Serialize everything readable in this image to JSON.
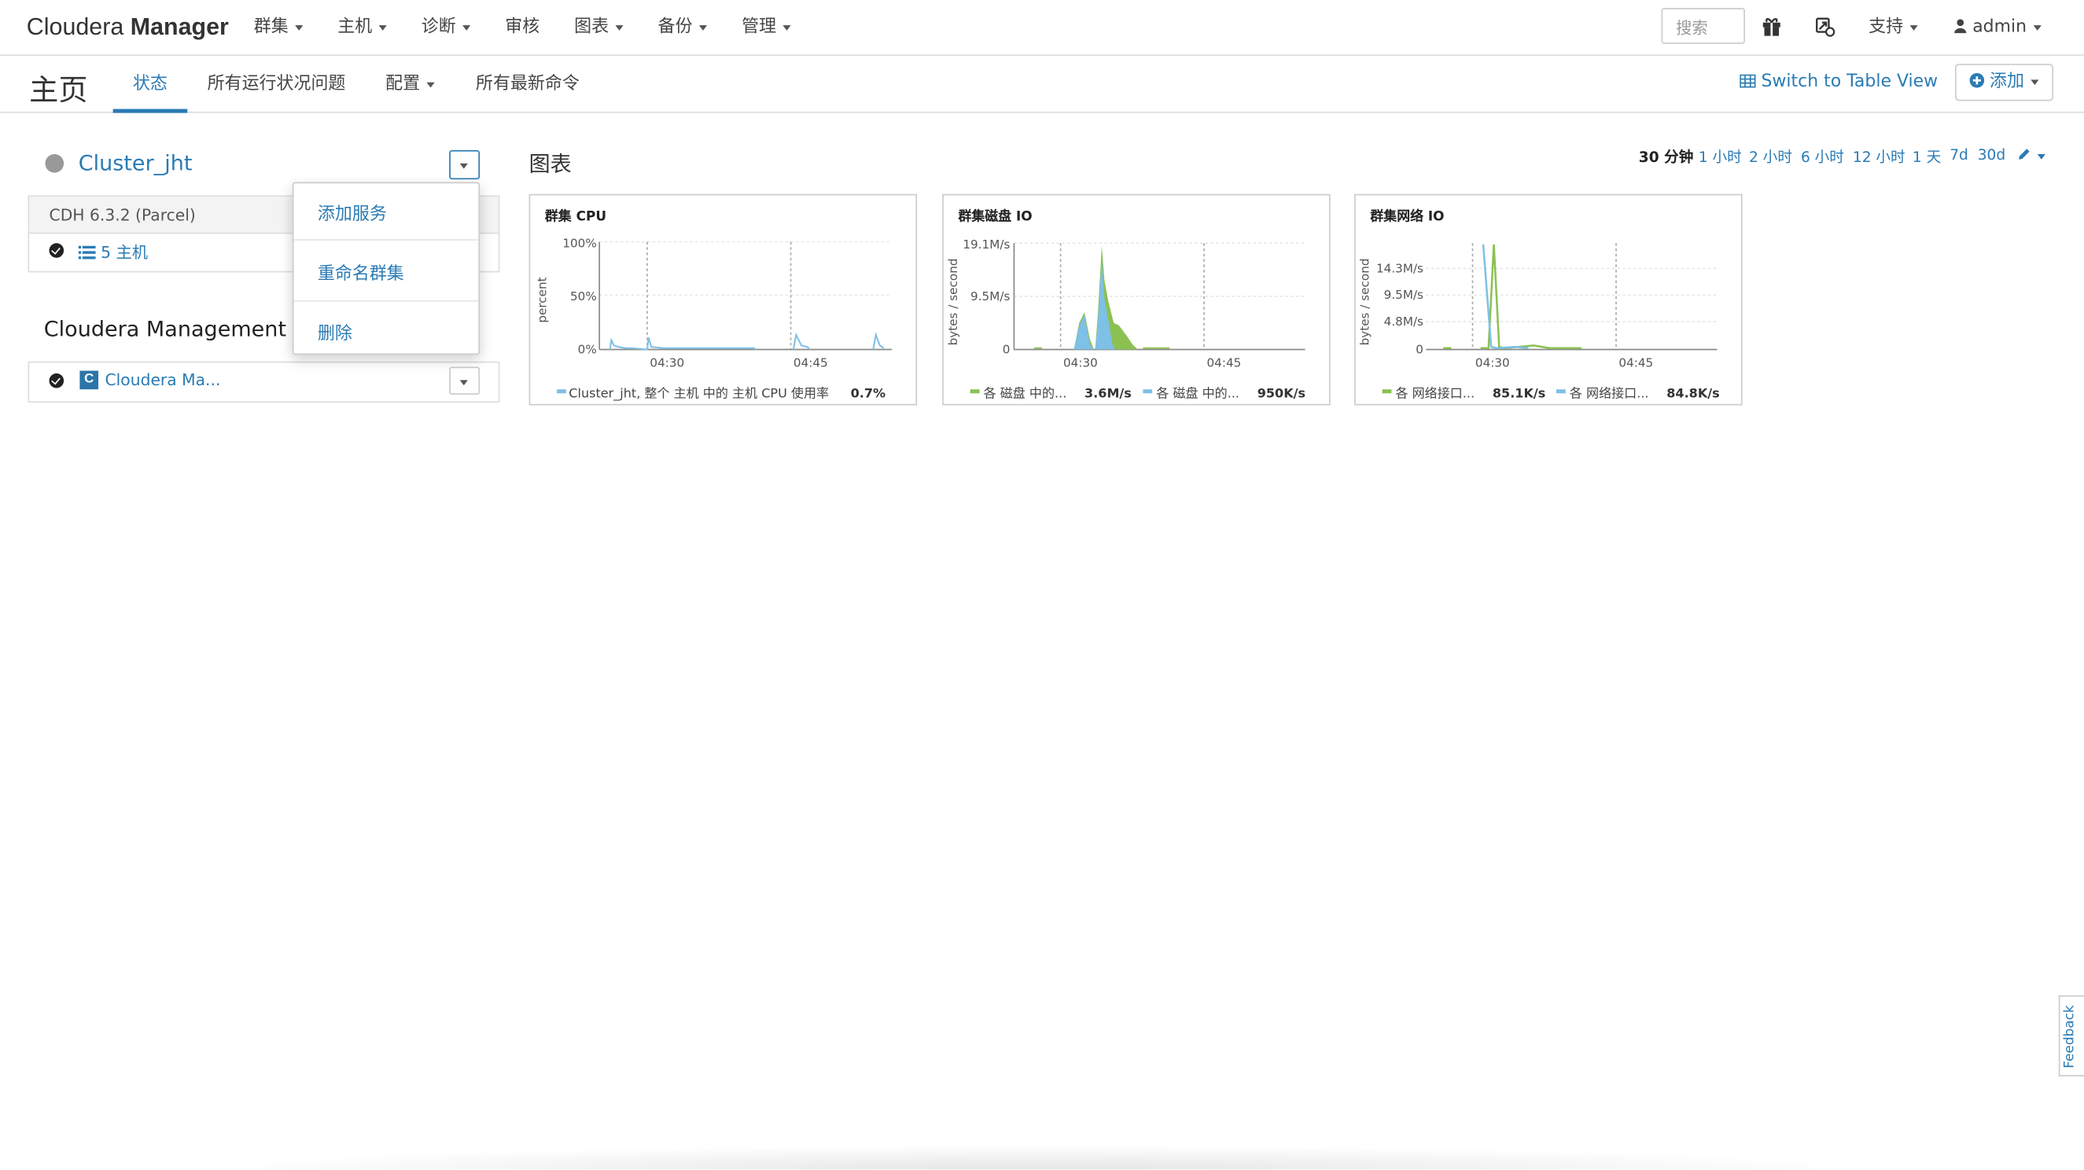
{
  "navbar": {
    "brand_light": "Cloudera",
    "brand_bold": "Manager",
    "menu": [
      "群集",
      "主机",
      "诊断",
      "审核",
      "图表",
      "备份",
      "管理"
    ],
    "search_placeholder": "搜索",
    "support": "支持",
    "user": "admin"
  },
  "subheader": {
    "title": "主页",
    "tabs": [
      "状态",
      "所有运行状况问题",
      "配置",
      "所有最新命令"
    ],
    "switch_view": "Switch to Table View",
    "add": "添加"
  },
  "cluster": {
    "name": "Cluster_jht",
    "version": "CDH 6.3.2 (Parcel)",
    "hosts": "5 主机"
  },
  "cluster_menu": [
    "添加服务",
    "重命名群集",
    "删除"
  ],
  "management": {
    "title": "Cloudera Management Se",
    "service": "Cloudera Ma..."
  },
  "charts_section": {
    "title": "图表",
    "ranges": [
      "30 分钟",
      "1 小时",
      "2 小时",
      "6 小时",
      "12 小时",
      "1 天",
      "7d",
      "30d"
    ],
    "active_range": "30 分钟"
  },
  "colors": {
    "link": "#2a7bb5",
    "green": "#8cc152",
    "blue": "#7ec0e6"
  },
  "chart_data": [
    {
      "type": "line",
      "title": "群集 CPU",
      "ylabel": "percent",
      "yticks": [
        "100%",
        "50%",
        "0%"
      ],
      "xticks": [
        "04:30",
        "04:45"
      ],
      "series": [
        {
          "name": "Cluster_jht, 整个 主机 中的 主机 CPU 使用率",
          "color": "#7ec0e6",
          "value": "0.7%"
        }
      ]
    },
    {
      "type": "area",
      "title": "群集磁盘 IO",
      "ylabel": "bytes / second",
      "yticks": [
        "19.1M/s",
        "9.5M/s",
        "0"
      ],
      "xticks": [
        "04:30",
        "04:45"
      ],
      "series": [
        {
          "name": "各 磁盘 中的...",
          "color": "#8cc152",
          "value": "3.6M/s"
        },
        {
          "name": "各 磁盘 中的...",
          "color": "#7ec0e6",
          "value": "950K/s"
        }
      ]
    },
    {
      "type": "line",
      "title": "群集网络 IO",
      "ylabel": "bytes / second",
      "yticks": [
        "14.3M/s",
        "9.5M/s",
        "4.8M/s",
        "0"
      ],
      "xticks": [
        "04:30",
        "04:45"
      ],
      "series": [
        {
          "name": "各 网络接口...",
          "color": "#8cc152",
          "value": "85.1K/s"
        },
        {
          "name": "各 网络接口...",
          "color": "#7ec0e6",
          "value": "84.8K/s"
        }
      ]
    }
  ],
  "feedback": "Feedback"
}
